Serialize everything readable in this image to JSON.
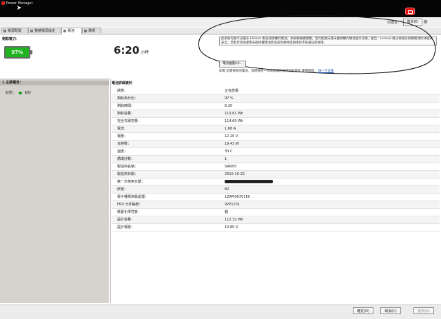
{
  "window": {
    "title": "Power Manager"
  },
  "header": {
    "switch_mode_label": "切換至：",
    "mode_button": "基本(E)"
  },
  "tabs": [
    {
      "label": "電源配置"
    },
    {
      "label": "整體電源設定"
    },
    {
      "label": "電池"
    },
    {
      "label": "選項"
    }
  ],
  "battery_panel": {
    "remaining_label": "剩餘電力：",
    "percent_text": "97%",
    "time_value": "6:20",
    "time_unit": "小時",
    "notice": "此系統可能不支援非 Lenovo 製造或授權的電池。系統將繼續開機，但可能無法替未獲授權的電池進行充電。警告：Lenovo 無法保證非兩種電池的效能與安全。若對於因為使用未經授權電池而造成的故障或損壞恕不負責任何保證。",
    "health_button": "電池維護(U)...",
    "info_text": "如需 您需要新的電池，或想要進一步瞭解關於如何延長電池 使用時間，",
    "info_link": "請一下這裡"
  },
  "left_pane": {
    "header": "1 主要電池：",
    "status_label": "狀態：",
    "status_value": "良好"
  },
  "details": {
    "title": "電池詳細資料",
    "rows": [
      {
        "key": "狀態：",
        "value": "正在放電"
      },
      {
        "key": "剩餘百分比：",
        "value": "97 %"
      },
      {
        "key": "剩餘時間：",
        "value": "6:20"
      },
      {
        "key": "剩餘容量：",
        "value": "110.81 Wh"
      },
      {
        "key": "完全充電容量：",
        "value": "114.60 Wh"
      },
      {
        "key": "電流：",
        "value": "1.68 A"
      },
      {
        "key": "電壓：",
        "value": "12.20 V"
      },
      {
        "key": "瓦特數：",
        "value": "19.43 W"
      },
      {
        "key": "溫度：",
        "value": "33 C"
      },
      {
        "key": "循環計數：",
        "value": "1"
      },
      {
        "key": "製造商名稱：",
        "value": "SANYO"
      },
      {
        "key": "製造商日期：",
        "value": "2010-10-22"
      },
      {
        "key": "第一次使用日期：",
        "value": ""
      },
      {
        "key": "序號：",
        "value": "82"
      },
      {
        "key": "電子種標高級處理：",
        "value": "1ZAM063V1E0"
      },
      {
        "key": "FRU 元件編號：",
        "value": "92P1131"
      },
      {
        "key": "裝置化學性質：",
        "value": "鋰"
      },
      {
        "key": "設計容量：",
        "value": "112.32 Wh"
      },
      {
        "key": "設計電壓：",
        "value": "10.80 V"
      }
    ]
  },
  "footer": {
    "ok": "確定(O)",
    "cancel": "取消(C)",
    "apply": "套用(A)"
  },
  "colors": {
    "battery_fill": "#1fb41f",
    "titlebar": "#050505",
    "alert_red": "#e01414"
  },
  "icons": {
    "app": "power-manager-icon",
    "tray_battery": "battery-alert-icon",
    "leaf": "leaf-icon"
  }
}
